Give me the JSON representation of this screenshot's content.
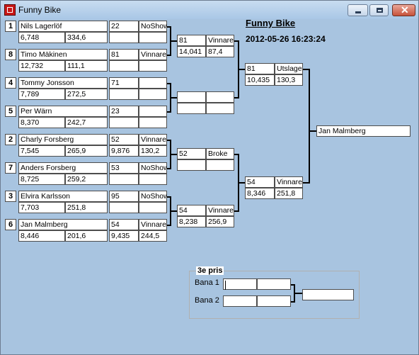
{
  "window": {
    "title": "Funny Bike"
  },
  "header": {
    "title": "Funny Bike",
    "datetime": "2012-05-26 16:23:24"
  },
  "round1": [
    {
      "seed": "1",
      "name": "Nils Lagerlöf",
      "time": "6,748",
      "speed": "334,6",
      "result_no": "22",
      "result": "NoShow",
      "result_time": "",
      "result_speed": ""
    },
    {
      "seed": "8",
      "name": "Timo Mäkinen",
      "time": "12,732",
      "speed": "111,1",
      "result_no": "81",
      "result": "Vinnare",
      "result_time": "",
      "result_speed": ""
    },
    {
      "seed": "4",
      "name": "Tommy Jonsson",
      "time": "7,789",
      "speed": "272,5",
      "result_no": "71",
      "result": "",
      "result_time": "",
      "result_speed": ""
    },
    {
      "seed": "5",
      "name": "Per Wärn",
      "time": "8,370",
      "speed": "242,7",
      "result_no": "23",
      "result": "",
      "result_time": "",
      "result_speed": ""
    },
    {
      "seed": "2",
      "name": "Charly Forsberg",
      "time": "7,545",
      "speed": "265,9",
      "result_no": "52",
      "result": "Vinnare",
      "result_time": "9,876",
      "result_speed": "130,2"
    },
    {
      "seed": "7",
      "name": "Anders Forsberg",
      "time": "8,725",
      "speed": "259,2",
      "result_no": "53",
      "result": "NoShow",
      "result_time": "",
      "result_speed": ""
    },
    {
      "seed": "3",
      "name": "Elvira Karlsson",
      "time": "7,703",
      "speed": "251,8",
      "result_no": "95",
      "result": "NoShow",
      "result_time": "",
      "result_speed": ""
    },
    {
      "seed": "6",
      "name": "Jan Malmberg",
      "time": "8,446",
      "speed": "201,6",
      "result_no": "54",
      "result": "Vinnare",
      "result_time": "9,435",
      "result_speed": "244,5"
    }
  ],
  "round2": [
    {
      "no": "81",
      "result": "Vinnare",
      "time": "14,041",
      "speed": "87,4"
    },
    {
      "no": "",
      "result": "",
      "time": "",
      "speed": ""
    },
    {
      "no": "52",
      "result": "Broke",
      "time": "",
      "speed": ""
    },
    {
      "no": "54",
      "result": "Vinnare",
      "time": "8,238",
      "speed": "256,9"
    }
  ],
  "round3": [
    {
      "no": "81",
      "result": "Utslagen",
      "time": "10,435",
      "speed": "130,3"
    },
    {
      "no": "54",
      "result": "Vinnare",
      "time": "8,346",
      "speed": "251,8"
    }
  ],
  "final": {
    "winner": "Jan Malmberg"
  },
  "third_place": {
    "title": "3e pris",
    "lanes": [
      {
        "label": "Bana 1",
        "a": "",
        "b": ""
      },
      {
        "label": "Bana 2",
        "a": "",
        "b": ""
      }
    ],
    "result": ""
  }
}
